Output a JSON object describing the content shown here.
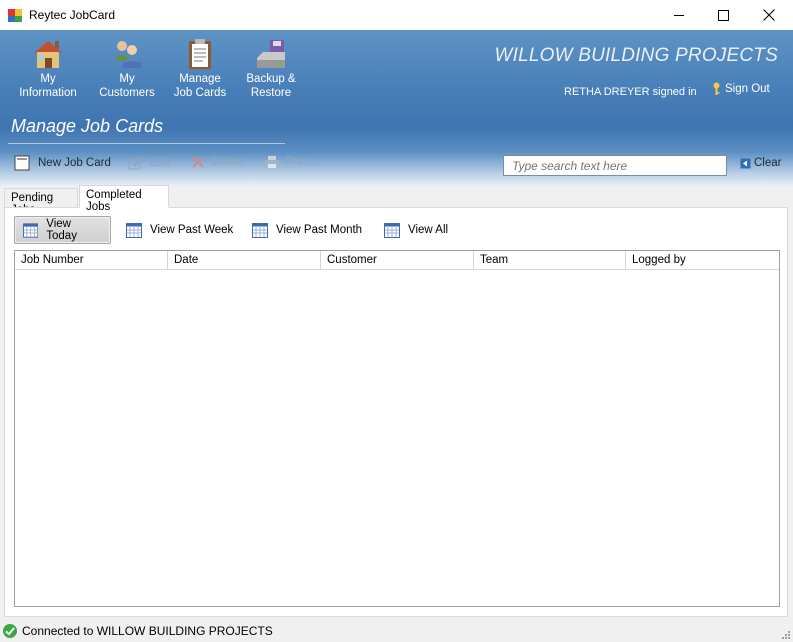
{
  "window": {
    "title": "Reytec JobCard"
  },
  "nav": {
    "my_information": {
      "line1": "My",
      "line2": "Information"
    },
    "my_customers": {
      "line1": "My",
      "line2": "Customers"
    },
    "manage_job_cards": {
      "line1": "Manage",
      "line2": "Job Cards"
    },
    "backup_restore": {
      "line1": "Backup &",
      "line2": "Restore"
    }
  },
  "header": {
    "company": "WILLOW BUILDING PROJECTS",
    "signed_in": "RETHA DREYER signed in",
    "sign_out": "Sign Out",
    "page_title": "Manage Job Cards"
  },
  "toolbar": {
    "new_job_card": "New Job Card",
    "edit": "Edit",
    "delete": "Delete",
    "print": "Print...",
    "search_placeholder": "Type search text here",
    "clear": "Clear"
  },
  "tabs": {
    "pending": "Pending Jobs",
    "completed": "Completed Jobs"
  },
  "views": {
    "today": "View Today",
    "past_week": "View Past Week",
    "past_month": "View Past Month",
    "all": "View All"
  },
  "grid": {
    "columns": [
      "Job Number",
      "Date",
      "Customer",
      "Team",
      "Logged by"
    ]
  },
  "status": {
    "text": "Connected to WILLOW BUILDING PROJECTS"
  }
}
